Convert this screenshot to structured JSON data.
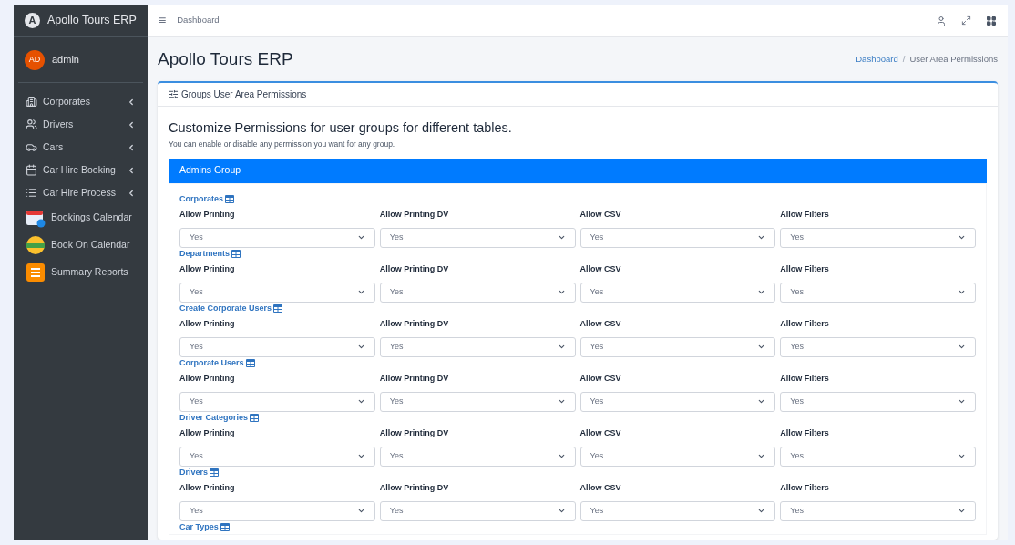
{
  "brand": {
    "logo": "A",
    "name": "Apollo Tours ERP"
  },
  "user": {
    "initials": "AD",
    "name": "admin"
  },
  "sidebar": {
    "items": [
      {
        "label": "Corporates",
        "expandable": true
      },
      {
        "label": "Drivers",
        "expandable": true
      },
      {
        "label": "Cars",
        "expandable": true
      },
      {
        "label": "Car Hire Booking",
        "expandable": true
      },
      {
        "label": "Car Hire Process",
        "expandable": true
      },
      {
        "label": "Bookings Calendar",
        "expandable": false
      },
      {
        "label": "Book On Calendar",
        "expandable": false
      },
      {
        "label": "Summary Reports",
        "expandable": false
      }
    ]
  },
  "topbar": {
    "menu_glyph": "≡",
    "link": "Dashboard"
  },
  "page": {
    "title": "Apollo Tours ERP",
    "breadcrumb": [
      "Dashboard",
      "User Area Permissions"
    ],
    "breadcrumb_separator": "/"
  },
  "card": {
    "title": "Groups User Area Permissions",
    "heading": "Customize Permissions for user groups for different tables.",
    "description": "You can enable or disable any permission you want for any group.",
    "group": {
      "title": "Admins Group",
      "sections": [
        {
          "name": "Corporates",
          "fields": [
            {
              "label": "Allow Printing",
              "value": "Yes"
            },
            {
              "label": "Allow Printing DV",
              "value": "Yes"
            },
            {
              "label": "Allow CSV",
              "value": "Yes"
            },
            {
              "label": "Allow Filters",
              "value": "Yes"
            }
          ]
        },
        {
          "name": "Departments",
          "fields": [
            {
              "label": "Allow Printing",
              "value": "Yes"
            },
            {
              "label": "Allow Printing DV",
              "value": "Yes"
            },
            {
              "label": "Allow CSV",
              "value": "Yes"
            },
            {
              "label": "Allow Filters",
              "value": "Yes"
            }
          ]
        },
        {
          "name": "Create Corporate Users",
          "fields": [
            {
              "label": "Allow Printing",
              "value": "Yes"
            },
            {
              "label": "Allow Printing DV",
              "value": "Yes"
            },
            {
              "label": "Allow CSV",
              "value": "Yes"
            },
            {
              "label": "Allow Filters",
              "value": "Yes"
            }
          ]
        },
        {
          "name": "Corporate Users",
          "fields": [
            {
              "label": "Allow Printing",
              "value": "Yes"
            },
            {
              "label": "Allow Printing DV",
              "value": "Yes"
            },
            {
              "label": "Allow CSV",
              "value": "Yes"
            },
            {
              "label": "Allow Filters",
              "value": "Yes"
            }
          ]
        },
        {
          "name": "Driver Categories",
          "fields": [
            {
              "label": "Allow Printing",
              "value": "Yes"
            },
            {
              "label": "Allow Printing DV",
              "value": "Yes"
            },
            {
              "label": "Allow CSV",
              "value": "Yes"
            },
            {
              "label": "Allow Filters",
              "value": "Yes"
            }
          ]
        },
        {
          "name": "Drivers",
          "fields": [
            {
              "label": "Allow Printing",
              "value": "Yes"
            },
            {
              "label": "Allow Printing DV",
              "value": "Yes"
            },
            {
              "label": "Allow CSV",
              "value": "Yes"
            },
            {
              "label": "Allow Filters",
              "value": "Yes"
            }
          ]
        },
        {
          "name": "Car Types"
        }
      ]
    }
  }
}
